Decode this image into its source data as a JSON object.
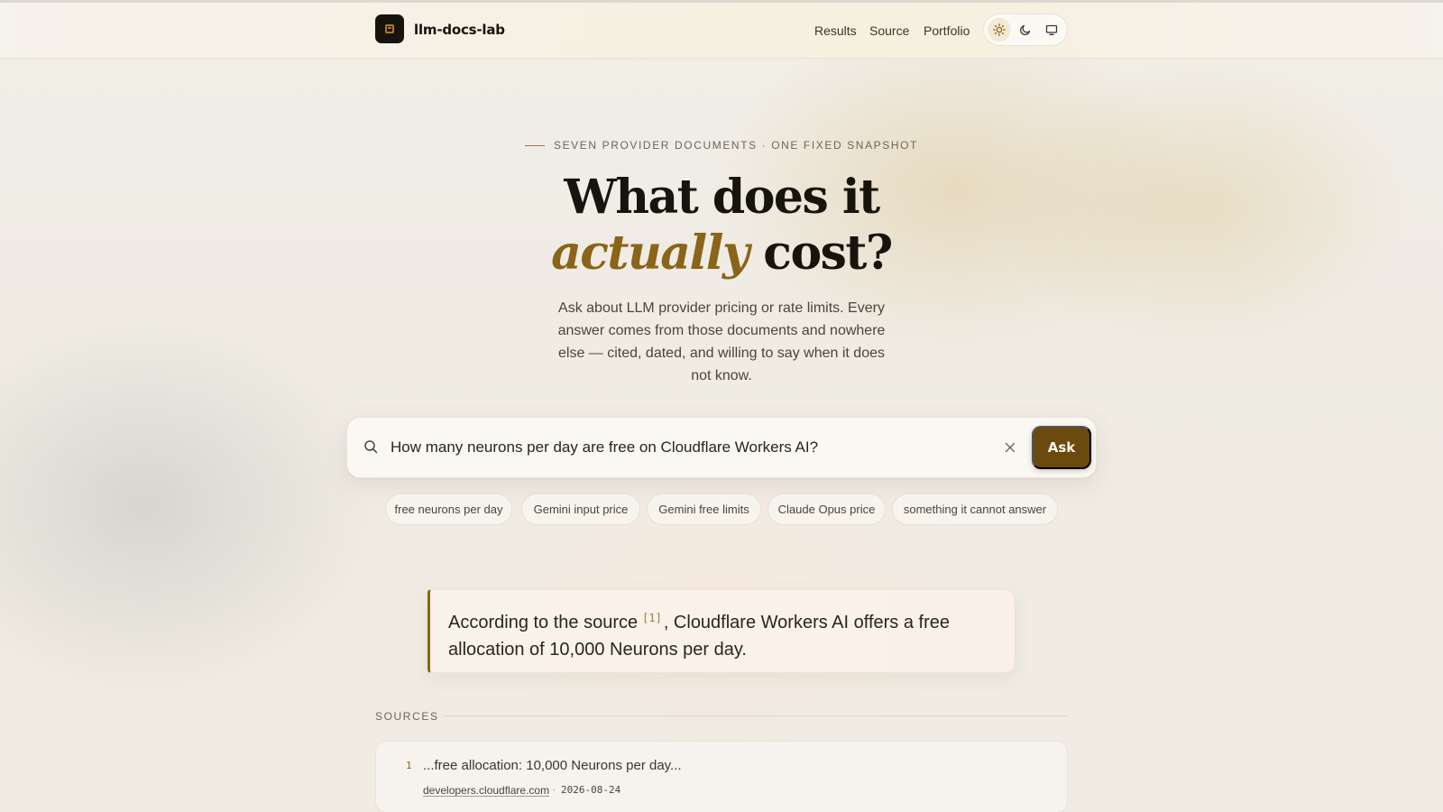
{
  "header": {
    "brand": "llm-docs-lab",
    "nav": [
      "Results",
      "Source",
      "Portfolio"
    ],
    "theme_options": [
      "light-icon",
      "dark-icon",
      "system-icon"
    ],
    "active_theme": "light"
  },
  "hero": {
    "eyebrow": "SEVEN PROVIDER DOCUMENTS · ONE FIXED SNAPSHOT",
    "title_line1": "What does it",
    "title_accent": "actually",
    "title_rest": " cost?",
    "subtitle": "Ask about LLM provider pricing or rate limits. Every answer comes from those documents and nowhere else — cited, dated, and willing to say when it does not know."
  },
  "search": {
    "query": "How many neurons per day are free on Cloudflare Workers AI?",
    "ask_label": "Ask"
  },
  "suggestions": [
    "free neurons per day",
    "Gemini input price",
    "Gemini free limits",
    "Claude Opus price",
    "something it cannot answer"
  ],
  "answer": {
    "prefix": "According to the source",
    "citation": "[1]",
    "suffix": ", Cloudflare Workers AI offers a free allocation of 10,000 Neurons per day."
  },
  "sources": {
    "label": "SOURCES",
    "items": [
      {
        "num": "1",
        "snippet": "...free allocation: 10,000 Neurons per day...",
        "domain": "developers.cloudflare.com",
        "separator": "·",
        "date": "2026-08-24"
      }
    ]
  },
  "colors": {
    "accent": "#8a6418",
    "button": "#6b4a10",
    "text": "#17130d"
  }
}
